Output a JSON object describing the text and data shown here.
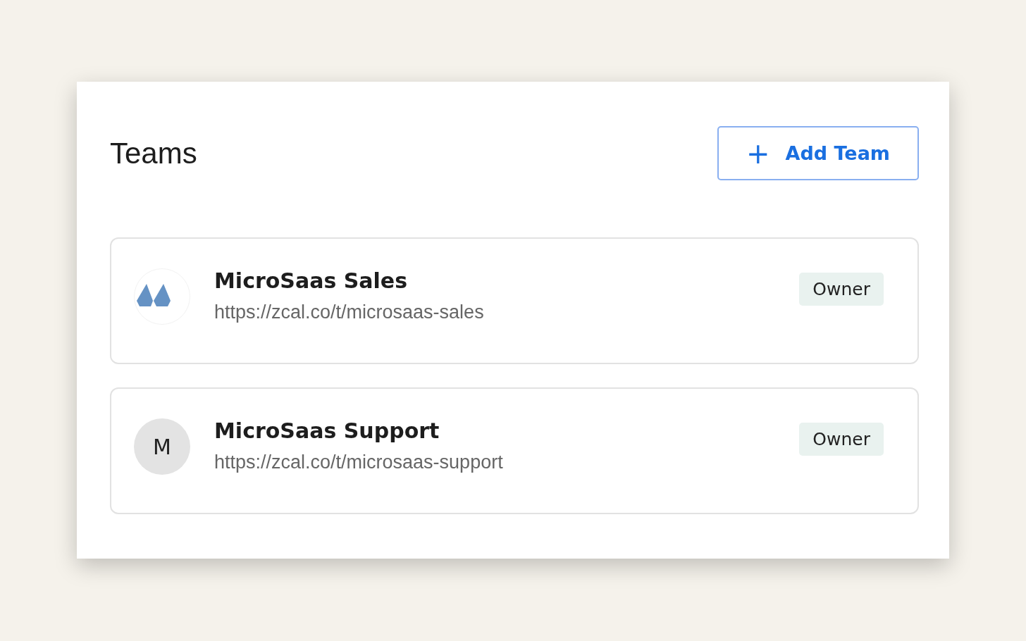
{
  "title": "Teams",
  "add_button": {
    "icon": "+",
    "label": "Add Team"
  },
  "teams": [
    {
      "name": "MicroSaas Sales",
      "url": "https://zcal.co/t/microsaas-sales",
      "role": "Owner",
      "avatar": {
        "kind": "logo"
      }
    },
    {
      "name": "MicroSaas Support",
      "url": "https://zcal.co/t/microsaas-support",
      "role": "Owner",
      "avatar": {
        "kind": "initial",
        "text": "M"
      }
    }
  ]
}
